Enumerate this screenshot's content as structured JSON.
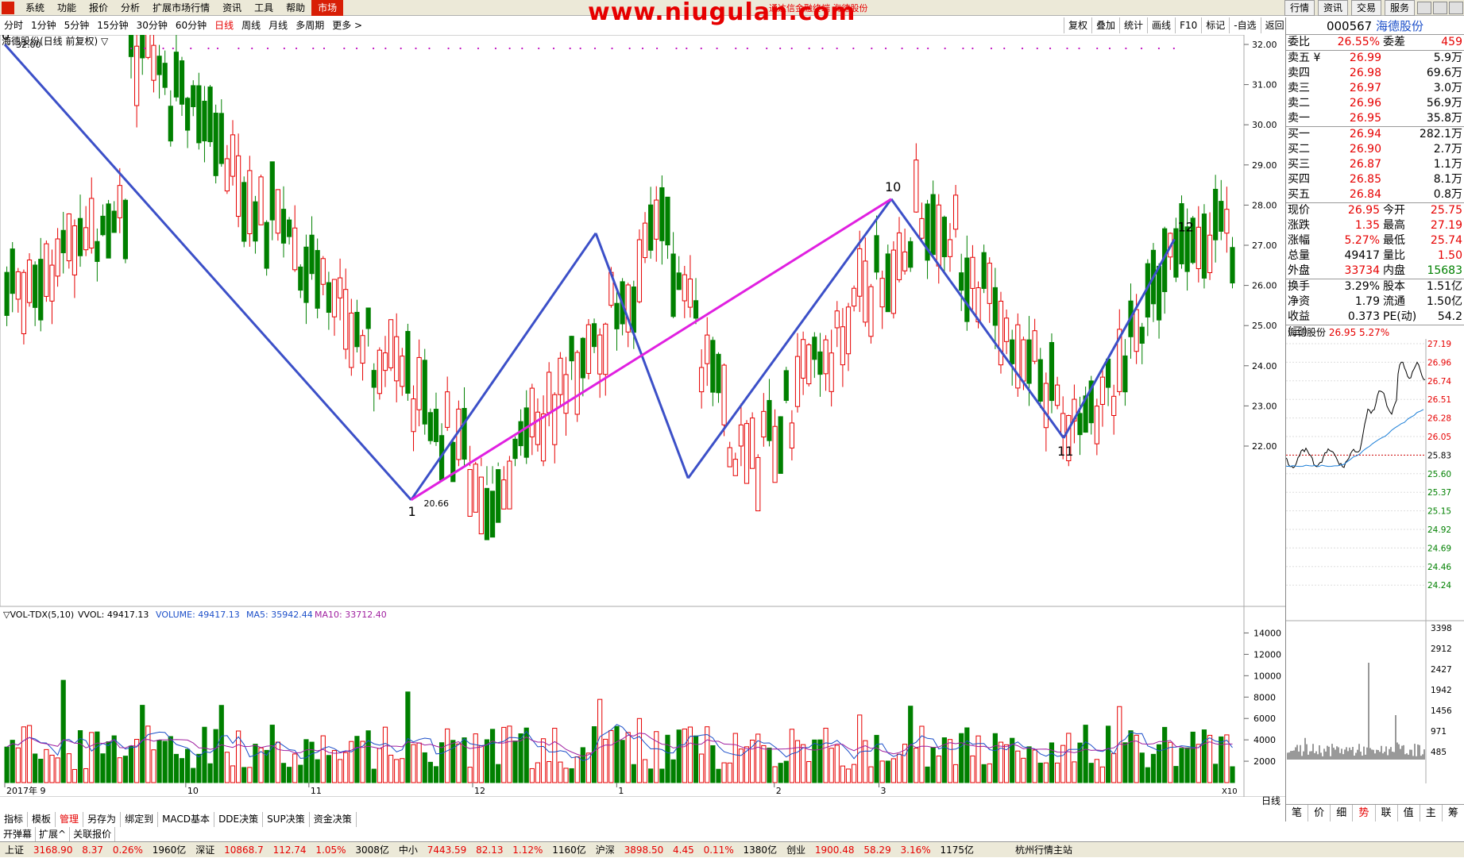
{
  "menu": {
    "items": [
      "系统",
      "功能",
      "报价",
      "分析",
      "扩展市场行情",
      "资讯",
      "工具",
      "帮助",
      "市场"
    ],
    "watermark": "www.niugulan.com",
    "subtitle": "通达信金融终端 海德股份"
  },
  "top_buttons": [
    "行情",
    "资讯",
    "交易",
    "服务"
  ],
  "periods": [
    "分时",
    "1分钟",
    "5分钟",
    "15分钟",
    "30分钟",
    "60分钟",
    "日线",
    "周线",
    "月线",
    "多周期",
    "更多 >"
  ],
  "selected_period": "日线",
  "tools": [
    "复权",
    "叠加",
    "统计",
    "画线",
    "F10",
    "标记",
    "-自选",
    "返回"
  ],
  "chart_title": "海德股份(日线 前复权) ▽",
  "vol_legend": {
    "name": "▽VOL-TDX(5,10)",
    "vvol": "VVOL: 49417.13",
    "volume": "VOLUME: 49417.13",
    "ma5": "MA5: 35942.44",
    "ma10": "MA10: 33712.40"
  },
  "colors": {
    "up": "#e60000",
    "down": "#008000",
    "blue_line": "#3c50c8",
    "magenta_line": "#e020e0"
  },
  "chart_data": {
    "type": "candlestick",
    "price_axis": [
      "32.00",
      "31.00",
      "30.00",
      "29.00",
      "28.00",
      "27.00",
      "26.00",
      "25.00",
      "24.00",
      "23.00",
      "22.00"
    ],
    "volume_axis": [
      "14000",
      "12000",
      "10000",
      "8000",
      "6000",
      "4000",
      "2000"
    ],
    "volume_unit": "X10",
    "date_axis": [
      "2017年 9",
      "10",
      "11",
      "12",
      "1",
      "2",
      "3"
    ],
    "annotations": {
      "high_label": "32.00",
      "low_label": "20.66",
      "wave_points": [
        "0",
        "1",
        "10",
        "11",
        "12"
      ]
    },
    "wave_line": [
      {
        "label": "0",
        "date_index": 0.0,
        "price": 32.0
      },
      {
        "label": "1",
        "date_index": 0.33,
        "price": 20.66
      },
      {
        "label": "",
        "date_index": 0.48,
        "price": 27.3
      },
      {
        "label": "",
        "date_index": 0.555,
        "price": 21.2
      },
      {
        "label": "10",
        "date_index": 0.72,
        "price": 28.15
      },
      {
        "label": "11",
        "date_index": 0.86,
        "price": 22.2
      },
      {
        "label": "12",
        "date_index": 0.95,
        "price": 27.15
      }
    ],
    "magenta_line": [
      {
        "date_index": 0.33,
        "price": 20.66
      },
      {
        "date_index": 0.72,
        "price": 28.15
      }
    ]
  },
  "quote": {
    "code": "000567",
    "name": "海德股份",
    "weibi": {
      "label": "委比",
      "value": "26.55%",
      "label2": "委差",
      "value2": "459"
    },
    "asks": [
      {
        "label": "卖五 ¥",
        "price": "26.99",
        "vol": "5.9万"
      },
      {
        "label": "卖四",
        "price": "26.98",
        "vol": "69.6万"
      },
      {
        "label": "卖三",
        "price": "26.97",
        "vol": "3.0万"
      },
      {
        "label": "卖二",
        "price": "26.96",
        "vol": "56.9万"
      },
      {
        "label": "卖一",
        "price": "26.95",
        "vol": "35.8万"
      }
    ],
    "bids": [
      {
        "label": "买一",
        "price": "26.94",
        "vol": "282.1万"
      },
      {
        "label": "买二",
        "price": "26.90",
        "vol": "2.7万"
      },
      {
        "label": "买三",
        "price": "26.87",
        "vol": "1.1万"
      },
      {
        "label": "买四",
        "price": "26.85",
        "vol": "8.1万"
      },
      {
        "label": "买五",
        "price": "26.84",
        "vol": "0.8万"
      }
    ],
    "stats": [
      {
        "a": "现价",
        "b": "26.95",
        "bc": "red",
        "c": "今开",
        "d": "25.75",
        "dc": "red"
      },
      {
        "a": "涨跌",
        "b": "1.35",
        "bc": "red",
        "c": "最高",
        "d": "27.19",
        "dc": "red"
      },
      {
        "a": "涨幅",
        "b": "5.27%",
        "bc": "red",
        "c": "最低",
        "d": "25.74",
        "dc": "red"
      },
      {
        "a": "总量",
        "b": "49417",
        "bc": "",
        "c": "量比",
        "d": "1.50",
        "dc": "red"
      },
      {
        "a": "外盘",
        "b": "33734",
        "bc": "red",
        "c": "内盘",
        "d": "15683",
        "dc": "grn"
      }
    ],
    "stats2": [
      {
        "a": "换手",
        "b": "3.29%",
        "c": "股本",
        "d": "1.51亿"
      },
      {
        "a": "净资",
        "b": "1.79",
        "c": "流通",
        "d": "1.50亿"
      },
      {
        "a": "收益(三)",
        "b": "0.373",
        "c": "PE(动)",
        "d": "54.2"
      }
    ],
    "mini_title": {
      "name": "海德股份",
      "price": "26.95",
      "pct": "5.27%"
    },
    "mini_axis": [
      "27.19",
      "26.96",
      "26.74",
      "26.51",
      "26.28",
      "26.05",
      "25.83",
      "25.60",
      "25.37",
      "25.15",
      "24.92",
      "24.69",
      "24.46",
      "24.24"
    ],
    "mini_vol_axis": [
      "3398",
      "2912",
      "2427",
      "1942",
      "1456",
      "971",
      "485"
    ],
    "tabs": [
      "笔",
      "价",
      "细",
      "势",
      "联",
      "值",
      "主",
      "筹"
    ],
    "selected_tab": "势"
  },
  "bottom_tabs1": [
    "指标",
    "模板",
    "管理",
    "另存为",
    "绑定到",
    "MACD基本",
    "DDE决策",
    "SUP决策",
    "资金决策"
  ],
  "bottom_tabs1_selected": "管理",
  "bottom_tabs2": [
    "开弹幕",
    "扩展^",
    "关联报价"
  ],
  "period_right_label": "日线",
  "status": [
    {
      "name": "上证",
      "val": "3168.90",
      "chg": "8.37",
      "pct": "0.26%",
      "amt": "1960亿"
    },
    {
      "name": "深证",
      "val": "10868.7",
      "chg": "112.74",
      "pct": "1.05%",
      "amt": "3008亿"
    },
    {
      "name": "中小",
      "val": "7443.59",
      "chg": "82.13",
      "pct": "1.12%",
      "amt": "1160亿"
    },
    {
      "name": "沪深",
      "val": "3898.50",
      "chg": "4.45",
      "pct": "0.11%",
      "amt": "1380亿"
    },
    {
      "name": "创业",
      "val": "1900.48",
      "chg": "58.29",
      "pct": "3.16%",
      "amt": "1175亿"
    }
  ],
  "status_site": "杭州行情主站"
}
